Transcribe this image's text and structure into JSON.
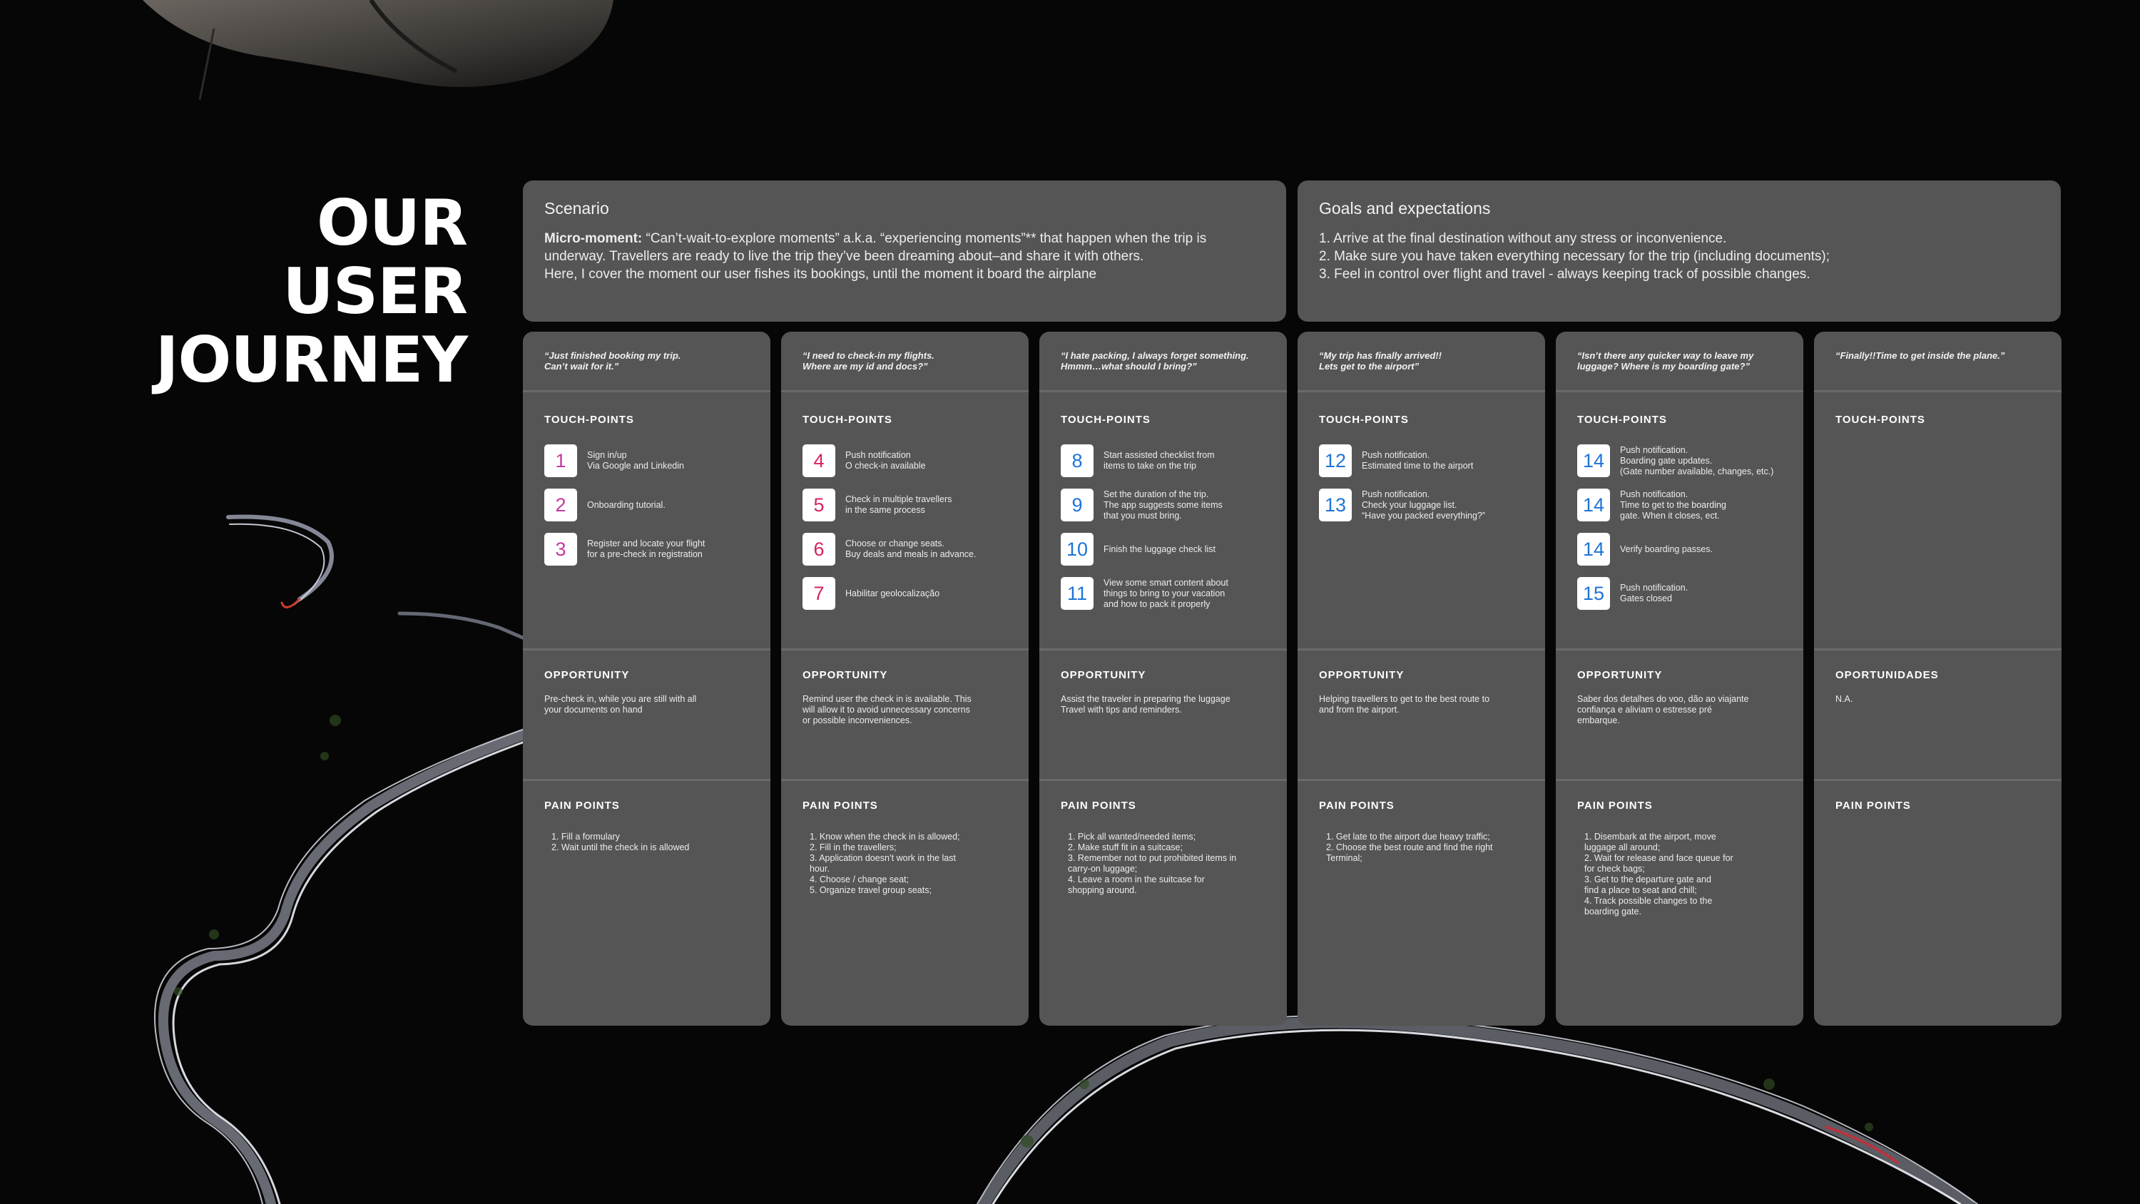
{
  "title": {
    "line1": "OUR USER",
    "line2": "JOURNEY"
  },
  "colors": {
    "magenta": "#c23aa3",
    "pink": "#d6245e",
    "blue": "#1e74d6",
    "panel": "#555555",
    "background": "#060606"
  },
  "scenario": {
    "heading": "Scenario",
    "bold": "Micro-moment: ",
    "line1": "“Can’t-wait-to-explore moments” a.k.a. “experiencing moments”** that happen when the trip is",
    "line2": "underway. Travellers are ready to live the trip they’ve been dreaming about–and share it with others.",
    "line3": "Here, I cover the moment our user fishes its bookings, until the moment it board the airplane"
  },
  "goals": {
    "heading": "Goals and expectations",
    "items": [
      "1. Arrive at the final destination without any stress or inconvenience.",
      "2. Make sure you have taken everything necessary for the trip (including documents);",
      "3. Feel in control over flight and travel - always keeping track of possible changes."
    ]
  },
  "columns": [
    {
      "quote": "“Just finished booking my trip.\nCan’t wait for it.”",
      "touchpoints_label": "TOUCH-POINTS",
      "touchpoints": [
        {
          "num": "1",
          "text": "Sign in/up\nVia Google and Linkedin",
          "color": "#c23aa3"
        },
        {
          "num": "2",
          "text": "Onboarding tutorial.",
          "color": "#c23aa3"
        },
        {
          "num": "3",
          "text": "Register and locate your flight\nfor a pre-check in registration",
          "color": "#c23aa3"
        }
      ],
      "opportunity_label": "OPPORTUNITY",
      "opportunity": "Pre-check in, while you are still with all\nyour documents on hand",
      "pain_label": "PAIN POINTS",
      "pain": "1. Fill a formulary\n2. Wait until the check in is allowed"
    },
    {
      "quote": "“I need to check-in my flights.\nWhere are my id and docs?”",
      "touchpoints_label": "TOUCH-POINTS",
      "touchpoints": [
        {
          "num": "4",
          "text": "Push notification\nO check-in available",
          "color": "#d6245e"
        },
        {
          "num": "5",
          "text": "Check in multiple travellers\nin the same process",
          "color": "#d6245e"
        },
        {
          "num": "6",
          "text": "Choose or change seats.\nBuy deals and meals in advance.",
          "color": "#d6245e"
        },
        {
          "num": "7",
          "text": "Habilitar geolocalização",
          "color": "#d6245e"
        }
      ],
      "opportunity_label": "OPPORTUNITY",
      "opportunity": "Remind user the check in is available. This\nwill allow it to avoid unnecessary concerns\nor possible inconveniences.",
      "pain_label": "PAIN POINTS",
      "pain": "1. Know when the check in is allowed;\n2. Fill in the travellers;\n3. Application doesn’t work in the last\nhour.\n4. Choose / change seat;\n5. Organize travel group seats;"
    },
    {
      "quote": "“I hate packing, I always forget something.\nHmmm…what should I bring?”",
      "touchpoints_label": "TOUCH-POINTS",
      "touchpoints": [
        {
          "num": "8",
          "text": "Start assisted checklist from\nitems to take on the trip",
          "color": "#1e74d6"
        },
        {
          "num": "9",
          "text": "Set the duration of the trip.\nThe app suggests some items\nthat you must bring.",
          "color": "#1e74d6"
        },
        {
          "num": "10",
          "text": "Finish the luggage check list",
          "color": "#1e74d6"
        },
        {
          "num": "11",
          "text": "View some smart content about\nthings to bring to your vacation\nand how to pack it properly",
          "color": "#1e74d6"
        }
      ],
      "opportunity_label": "OPPORTUNITY",
      "opportunity": "Assist the traveler in preparing the luggage\nTravel with tips and reminders.",
      "pain_label": "PAIN POINTS",
      "pain": "1. Pick all wanted/needed items;\n2. Make stuff fit in a suitcase;\n3. Remember not to put prohibited items in\ncarry-on luggage;\n4. Leave a room in the suitcase for\nshopping around."
    },
    {
      "quote": "“My trip has finally arrived!!\nLets get to the airport”",
      "touchpoints_label": "TOUCH-POINTS",
      "touchpoints": [
        {
          "num": "12",
          "text": "Push notification.\nEstimated time to the airport",
          "color": "#1e74d6"
        },
        {
          "num": "13",
          "text": "Push notification.\nCheck your luggage list.\n“Have you packed everything?”",
          "color": "#1e74d6"
        }
      ],
      "opportunity_label": "OPPORTUNITY",
      "opportunity": "Helping travellers to get to the best route to\nand from the airport.",
      "pain_label": "PAIN POINTS",
      "pain": "1. Get late to the airport due heavy traffic;\n2. Choose the best route and find the right\nTerminal;"
    },
    {
      "quote": "“Isn’t there any quicker way to leave my\nluggage? Where is my boarding gate?”",
      "touchpoints_label": "TOUCH-POINTS",
      "touchpoints": [
        {
          "num": "14",
          "text": "Push notification.\nBoarding gate updates.\n(Gate number available, changes, etc.)",
          "color": "#1e74d6"
        },
        {
          "num": "14",
          "text": "Push notification.\nTime to get to the boarding\ngate. When it closes, ect.",
          "color": "#1e74d6"
        },
        {
          "num": "14",
          "text": "Verify boarding passes.",
          "color": "#1e74d6"
        },
        {
          "num": "15",
          "text": "Push notification.\nGates closed",
          "color": "#1e74d6"
        }
      ],
      "opportunity_label": "OPPORTUNITY",
      "opportunity": "Saber dos detalhes do voo, dão ao viajante\nconfiança e aliviam o estresse pré\nembarque.",
      "pain_label": "PAIN POINTS",
      "pain": "1. Disembark at the airport, move\nluggage all around;\n2. Wait for release and face queue for\nfor check bags;\n3. Get to the departure gate and\nfind a place to seat and chill;\n4. Track possible changes to the\nboarding gate."
    },
    {
      "quote": "“Finally!!Time to get inside the plane.”",
      "touchpoints_label": "TOUCH-POINTS",
      "touchpoints": [],
      "opportunity_label": "OPORTUNIDADES",
      "opportunity": "N.A.",
      "pain_label": "PAIN POINTS",
      "pain": ""
    }
  ]
}
